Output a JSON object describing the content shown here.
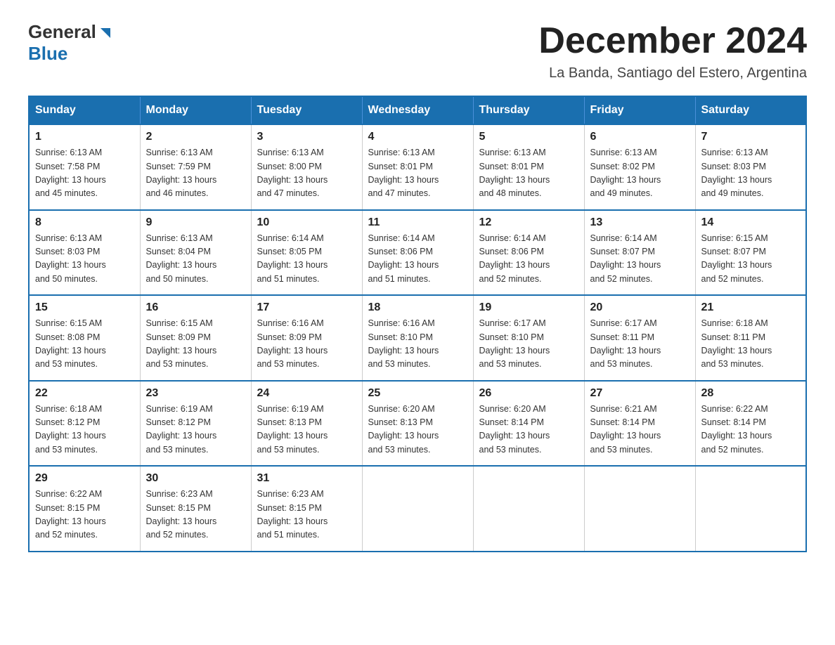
{
  "logo": {
    "general": "General",
    "blue": "Blue"
  },
  "title": "December 2024",
  "location": "La Banda, Santiago del Estero, Argentina",
  "weekdays": [
    "Sunday",
    "Monday",
    "Tuesday",
    "Wednesday",
    "Thursday",
    "Friday",
    "Saturday"
  ],
  "weeks": [
    [
      {
        "day": "1",
        "sunrise": "6:13 AM",
        "sunset": "7:58 PM",
        "daylight": "13 hours and 45 minutes."
      },
      {
        "day": "2",
        "sunrise": "6:13 AM",
        "sunset": "7:59 PM",
        "daylight": "13 hours and 46 minutes."
      },
      {
        "day": "3",
        "sunrise": "6:13 AM",
        "sunset": "8:00 PM",
        "daylight": "13 hours and 47 minutes."
      },
      {
        "day": "4",
        "sunrise": "6:13 AM",
        "sunset": "8:01 PM",
        "daylight": "13 hours and 47 minutes."
      },
      {
        "day": "5",
        "sunrise": "6:13 AM",
        "sunset": "8:01 PM",
        "daylight": "13 hours and 48 minutes."
      },
      {
        "day": "6",
        "sunrise": "6:13 AM",
        "sunset": "8:02 PM",
        "daylight": "13 hours and 49 minutes."
      },
      {
        "day": "7",
        "sunrise": "6:13 AM",
        "sunset": "8:03 PM",
        "daylight": "13 hours and 49 minutes."
      }
    ],
    [
      {
        "day": "8",
        "sunrise": "6:13 AM",
        "sunset": "8:03 PM",
        "daylight": "13 hours and 50 minutes."
      },
      {
        "day": "9",
        "sunrise": "6:13 AM",
        "sunset": "8:04 PM",
        "daylight": "13 hours and 50 minutes."
      },
      {
        "day": "10",
        "sunrise": "6:14 AM",
        "sunset": "8:05 PM",
        "daylight": "13 hours and 51 minutes."
      },
      {
        "day": "11",
        "sunrise": "6:14 AM",
        "sunset": "8:06 PM",
        "daylight": "13 hours and 51 minutes."
      },
      {
        "day": "12",
        "sunrise": "6:14 AM",
        "sunset": "8:06 PM",
        "daylight": "13 hours and 52 minutes."
      },
      {
        "day": "13",
        "sunrise": "6:14 AM",
        "sunset": "8:07 PM",
        "daylight": "13 hours and 52 minutes."
      },
      {
        "day": "14",
        "sunrise": "6:15 AM",
        "sunset": "8:07 PM",
        "daylight": "13 hours and 52 minutes."
      }
    ],
    [
      {
        "day": "15",
        "sunrise": "6:15 AM",
        "sunset": "8:08 PM",
        "daylight": "13 hours and 53 minutes."
      },
      {
        "day": "16",
        "sunrise": "6:15 AM",
        "sunset": "8:09 PM",
        "daylight": "13 hours and 53 minutes."
      },
      {
        "day": "17",
        "sunrise": "6:16 AM",
        "sunset": "8:09 PM",
        "daylight": "13 hours and 53 minutes."
      },
      {
        "day": "18",
        "sunrise": "6:16 AM",
        "sunset": "8:10 PM",
        "daylight": "13 hours and 53 minutes."
      },
      {
        "day": "19",
        "sunrise": "6:17 AM",
        "sunset": "8:10 PM",
        "daylight": "13 hours and 53 minutes."
      },
      {
        "day": "20",
        "sunrise": "6:17 AM",
        "sunset": "8:11 PM",
        "daylight": "13 hours and 53 minutes."
      },
      {
        "day": "21",
        "sunrise": "6:18 AM",
        "sunset": "8:11 PM",
        "daylight": "13 hours and 53 minutes."
      }
    ],
    [
      {
        "day": "22",
        "sunrise": "6:18 AM",
        "sunset": "8:12 PM",
        "daylight": "13 hours and 53 minutes."
      },
      {
        "day": "23",
        "sunrise": "6:19 AM",
        "sunset": "8:12 PM",
        "daylight": "13 hours and 53 minutes."
      },
      {
        "day": "24",
        "sunrise": "6:19 AM",
        "sunset": "8:13 PM",
        "daylight": "13 hours and 53 minutes."
      },
      {
        "day": "25",
        "sunrise": "6:20 AM",
        "sunset": "8:13 PM",
        "daylight": "13 hours and 53 minutes."
      },
      {
        "day": "26",
        "sunrise": "6:20 AM",
        "sunset": "8:14 PM",
        "daylight": "13 hours and 53 minutes."
      },
      {
        "day": "27",
        "sunrise": "6:21 AM",
        "sunset": "8:14 PM",
        "daylight": "13 hours and 53 minutes."
      },
      {
        "day": "28",
        "sunrise": "6:22 AM",
        "sunset": "8:14 PM",
        "daylight": "13 hours and 52 minutes."
      }
    ],
    [
      {
        "day": "29",
        "sunrise": "6:22 AM",
        "sunset": "8:15 PM",
        "daylight": "13 hours and 52 minutes."
      },
      {
        "day": "30",
        "sunrise": "6:23 AM",
        "sunset": "8:15 PM",
        "daylight": "13 hours and 52 minutes."
      },
      {
        "day": "31",
        "sunrise": "6:23 AM",
        "sunset": "8:15 PM",
        "daylight": "13 hours and 51 minutes."
      },
      null,
      null,
      null,
      null
    ]
  ],
  "labels": {
    "sunrise": "Sunrise:",
    "sunset": "Sunset:",
    "daylight": "Daylight:"
  }
}
